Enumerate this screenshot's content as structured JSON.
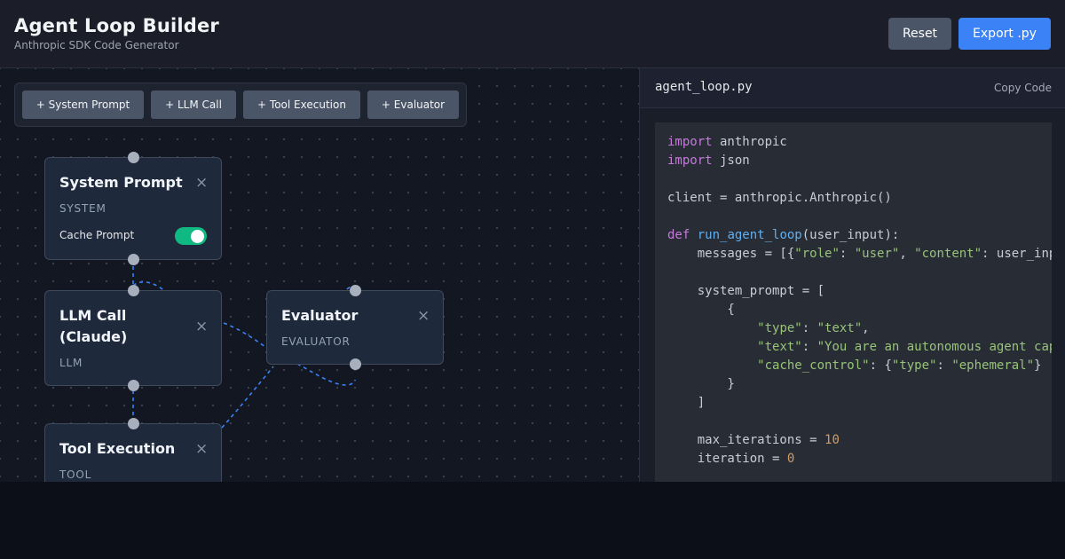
{
  "header": {
    "title": "Agent Loop Builder",
    "subtitle": "Anthropic SDK Code Generator",
    "reset_label": "Reset",
    "export_label": "Export .py"
  },
  "toolbar": {
    "buttons": [
      "+ System Prompt",
      "+ LLM Call",
      "+ Tool Execution",
      "+ Evaluator"
    ]
  },
  "nodes": {
    "system_prompt": {
      "title": "System Prompt",
      "type": "SYSTEM",
      "cache_label": "Cache Prompt",
      "cache_enabled": true
    },
    "llm_call": {
      "title_line1": "LLM Call",
      "title_line2": "(Claude)",
      "type": "LLM"
    },
    "evaluator": {
      "title": "Evaluator",
      "type": "EVALUATOR"
    },
    "tool_execution": {
      "title": "Tool Execution",
      "type": "TOOL"
    },
    "close_glyph": "×"
  },
  "code_panel": {
    "filename": "agent_loop.py",
    "copy_label": "Copy Code",
    "lines": [
      [
        [
          "kw",
          "import"
        ],
        [
          "t",
          " anthropic"
        ]
      ],
      [
        [
          "kw",
          "import"
        ],
        [
          "t",
          " json"
        ]
      ],
      [],
      [
        [
          "t",
          "client = anthropic.Anthropic()"
        ]
      ],
      [],
      [
        [
          "kw",
          "def"
        ],
        [
          "t",
          " "
        ],
        [
          "fn",
          "run_agent_loop"
        ],
        [
          "t",
          "(user_input):"
        ]
      ],
      [
        [
          "t",
          "    messages = [{"
        ],
        [
          "str",
          "\"role\""
        ],
        [
          "t",
          ": "
        ],
        [
          "str",
          "\"user\""
        ],
        [
          "t",
          ", "
        ],
        [
          "str",
          "\"content\""
        ],
        [
          "t",
          ": user_input}]"
        ]
      ],
      [],
      [
        [
          "t",
          "    system_prompt = ["
        ]
      ],
      [
        [
          "t",
          "        {"
        ]
      ],
      [
        [
          "t",
          "            "
        ],
        [
          "str",
          "\"type\""
        ],
        [
          "t",
          ": "
        ],
        [
          "str",
          "\"text\""
        ],
        [
          "t",
          ","
        ]
      ],
      [
        [
          "t",
          "            "
        ],
        [
          "str",
          "\"text\""
        ],
        [
          "t",
          ": "
        ],
        [
          "str",
          "\"You are an autonomous agent capable of using tools.\""
        ],
        [
          "t",
          ","
        ]
      ],
      [
        [
          "t",
          "            "
        ],
        [
          "str",
          "\"cache_control\""
        ],
        [
          "t",
          ": {"
        ],
        [
          "str",
          "\"type\""
        ],
        [
          "t",
          ": "
        ],
        [
          "str",
          "\"ephemeral\""
        ],
        [
          "t",
          "}"
        ]
      ],
      [
        [
          "t",
          "        }"
        ]
      ],
      [
        [
          "t",
          "    ]"
        ]
      ],
      [],
      [
        [
          "t",
          "    max_iterations = "
        ],
        [
          "num",
          "10"
        ]
      ],
      [
        [
          "t",
          "    iteration = "
        ],
        [
          "num",
          "0"
        ]
      ]
    ]
  },
  "colors": {
    "accent": "#3b82f6",
    "toggle_on": "#10b981",
    "wire": "#3b82f6",
    "keyword": "#c678dd",
    "function": "#61afef",
    "string": "#98c379",
    "number": "#d19a66"
  }
}
